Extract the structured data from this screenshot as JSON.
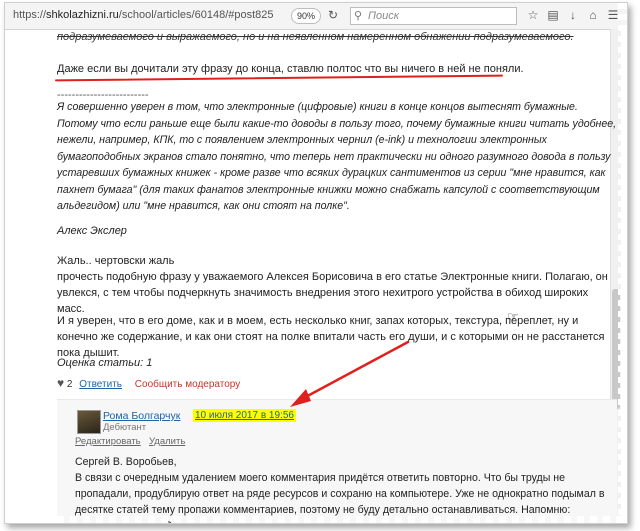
{
  "toolbar": {
    "url_prefix": "https://",
    "url_host": "shkolazhizni.ru",
    "url_path": "/school/articles/60148/#post825",
    "zoom": "90%",
    "search_placeholder": "Поиск"
  },
  "article": {
    "strike_line": "подразумеваемого и выражаемого, но и на неявленном намеренном обнажении подразумеваемого.",
    "highlight_line": "Даже если вы дочитали эту фразу до конца, ставлю полтос что вы ничего в ней не поняли.",
    "dashes": "-------------------------",
    "quote": "Я совершенно уверен в том, что электронные (цифровые) книги в конце концов вытеснят бумажные. Потому что если раньше еще были какие-то доводы в пользу того, почему бумажные книги читать удобнее, нежели, например, КПК, то с появлением электронных чернил (e-ink) и технологии электронных бумагоподобных экранов стало понятно, что теперь нет практически ни одного разумного довода в пользу устаревших бумажных книжек - кроме разве что всяких дурацких сантиментов из серии \"мне нравится, как пахнет бумага\" (для таких фанатов электронные книжки можно снабжать капсулой с соответствующим альдегидом) или \"мне нравится, как они стоят на полке\".",
    "author": "Алекс Экслер",
    "p1_line1": "Жаль.. чертовски жаль",
    "p1_line2": "прочесть подобную фразу у уважаемого Алексея Борисовича в его статье Электронные книги. Полагаю, он увлекся, с тем чтобы подчеркнуть значимость внедрения этого нехитрого устройства в обиход широких масс.",
    "p2": "И я уверен, что в его доме, как и в моем, есть несколько книг, запах которых, текстура, переплет, ну и конечно же содержание, и как они стоят на полке впитали часть его души, и с которыми он не расстанется пока дышит.",
    "rating": "Оценка статьи: 1"
  },
  "actions": {
    "likes": "2",
    "reply": "Ответить",
    "report": "Сообщить модератору"
  },
  "comment": {
    "name": "Рома Болгарчук",
    "role": "Дебютант",
    "date": "10 июля 2017 в 19:56",
    "edit": "Редактировать",
    "delete": "Удалить",
    "text": "Сергей В. Воробьев,\nВ связи с очередным удалением моего комментария придётся ответить повторно. Что бы труды не пропадали, продублирую ответ на ряде ресурсов и сохраню на компьютере. Уже не однократно подымал в десятке статей тему пропажи комментариев, поэтому не буду детально останавливаться. Напомню: пропажа постов в Рунета"
  },
  "colors": {
    "link": "#2062a8",
    "annotation_red": "#e0201c",
    "highlight": "#ffff00"
  }
}
